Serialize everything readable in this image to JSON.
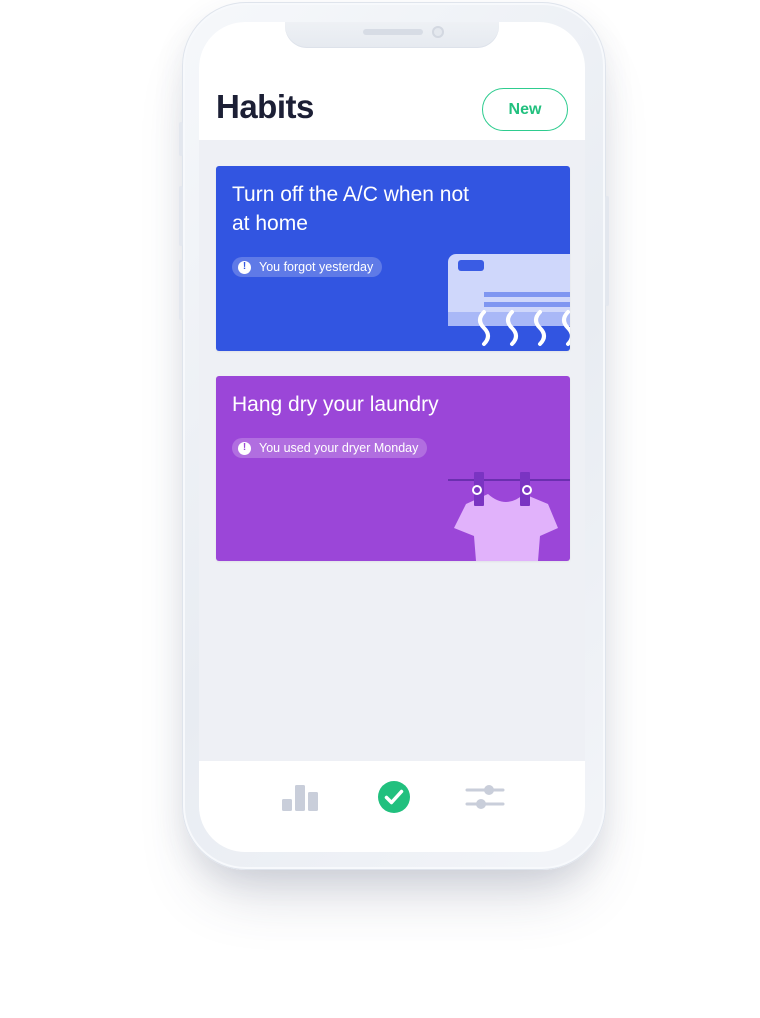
{
  "header": {
    "title": "Habits",
    "new_button_label": "New"
  },
  "habits": [
    {
      "title": "Turn off the A/C when not at home",
      "status": "You forgot yesterday",
      "color": "#3255e1",
      "illustration": "air-conditioner"
    },
    {
      "title": "Hang dry your laundry",
      "status": "You used your dryer Monday",
      "color": "#9b46d8",
      "illustration": "shirt-on-clothesline"
    }
  ],
  "nav": {
    "items": [
      {
        "icon": "bar-chart-icon",
        "active": false
      },
      {
        "icon": "check-circle-icon",
        "active": true
      },
      {
        "icon": "sliders-icon",
        "active": false
      }
    ]
  },
  "colors": {
    "accent": "#21c07e",
    "title": "#1c1f35",
    "background": "#eef0f5",
    "inactive_icon": "#c9ceda"
  }
}
